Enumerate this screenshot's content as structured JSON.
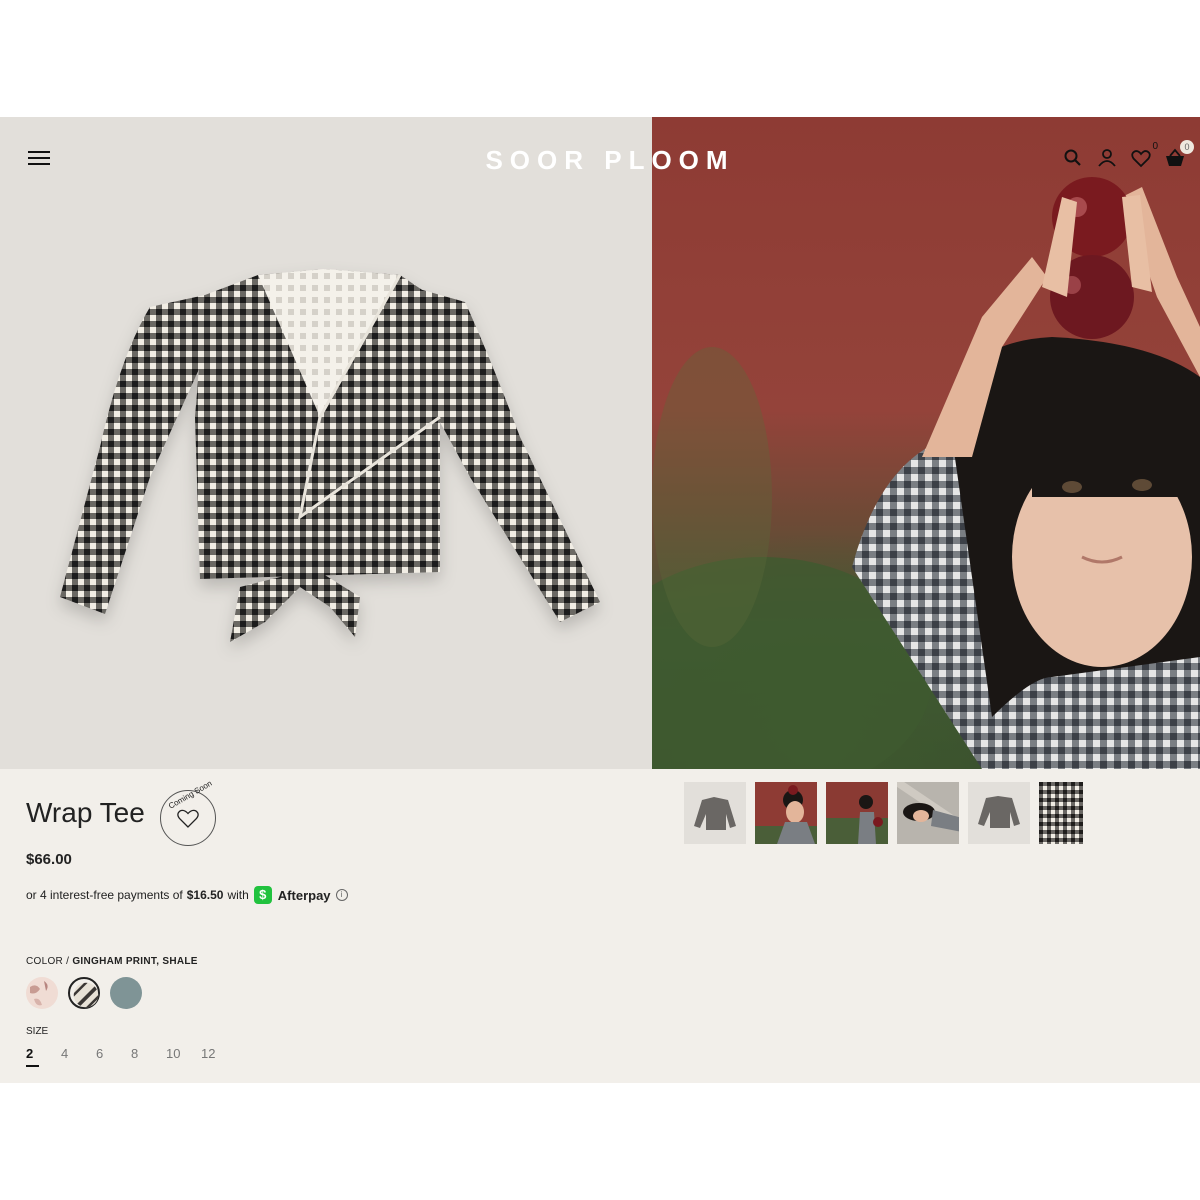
{
  "header": {
    "brand": "SOOR PLOOM",
    "wishlist_count": "0",
    "cart_count": "0"
  },
  "product": {
    "title": "Wrap Tee",
    "wishlist_tag": "Coming Soon",
    "price": "$66.00",
    "afterpay": {
      "prefix": "or 4 interest-free payments of",
      "amount": "$16.50",
      "with": "with",
      "provider": "Afterpay",
      "logo_glyph": "$",
      "info_glyph": "i"
    },
    "color": {
      "label": "COLOR /",
      "selected": "GINGHAM PRINT, SHALE",
      "swatches": [
        {
          "name": "pink-floral",
          "color": "#e8cfc6"
        },
        {
          "name": "gingham-shale",
          "color": "#3a3634"
        },
        {
          "name": "slate-blue",
          "color": "#7f9496"
        }
      ]
    },
    "size": {
      "label": "SIZE",
      "options": [
        "2",
        "4",
        "6",
        "8",
        "10",
        "12"
      ],
      "selected": "2"
    }
  },
  "thumbnails": [
    {
      "name": "flatlay-front"
    },
    {
      "name": "model-apples-red-wall"
    },
    {
      "name": "model-standing-red-wall"
    },
    {
      "name": "model-lying-stone"
    },
    {
      "name": "flatlay-back"
    },
    {
      "name": "gingham-detail"
    }
  ],
  "colors": {
    "page_bg": "#f2efea",
    "hero_left_bg": "#e2dfda",
    "afterpay_green": "#21c23e"
  }
}
